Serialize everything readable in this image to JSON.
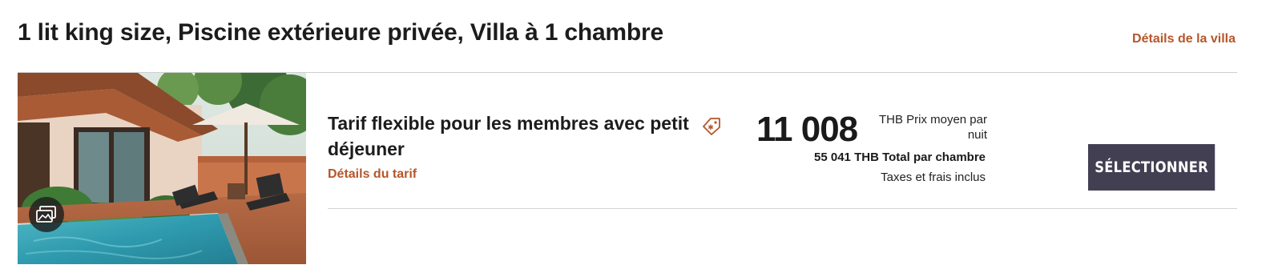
{
  "room": {
    "title": "1 lit king size, Piscine extérieure privée, Villa à 1 chambre",
    "details_link": "Détails de la villa",
    "photo_alt": "Villa avec piscine privée, transats et parasol"
  },
  "rate": {
    "name": "Tarif flexible pour les membres avec petit déjeuner",
    "details_link": "Détails du tarif",
    "icon": "member-tag-icon"
  },
  "price": {
    "nightly": "11 008",
    "nightly_label": "THB Prix moyen par nuit",
    "total_amount": "55 041",
    "total_label": "THB Total par chambre",
    "taxes": "Taxes et frais inclus"
  },
  "actions": {
    "select_label": "SÉLECTIONNER"
  },
  "colors": {
    "accent": "#b5562a",
    "button": "#433f52",
    "divider": "#cfcfcf"
  }
}
